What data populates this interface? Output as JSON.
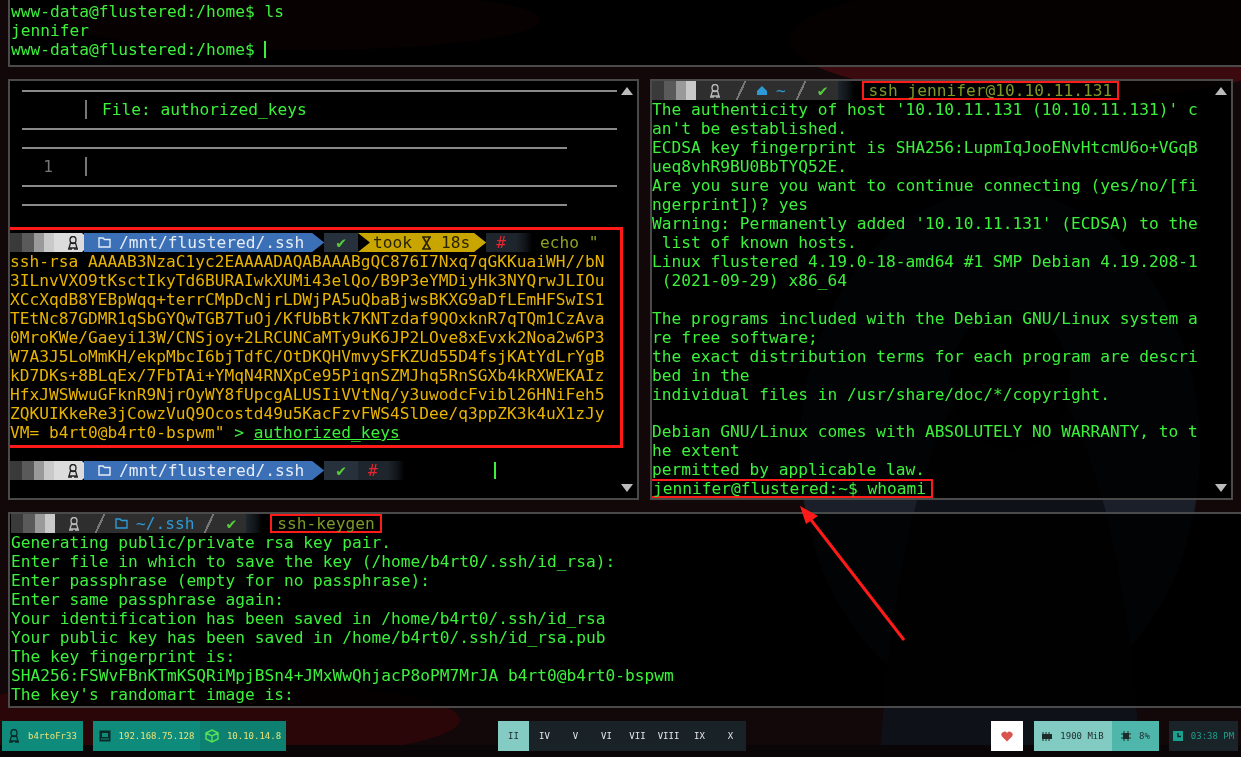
{
  "top_pane": {
    "lines": [
      {
        "text": "www-data@flustered:/home$ ls",
        "cursor": false
      },
      {
        "text": "jennifer",
        "cursor": false
      },
      {
        "text": "www-data@flustered:/home$ ",
        "cursor": true
      }
    ]
  },
  "left_pane": {
    "file_header": {
      "label": "File: authorized_keys",
      "line_number": "1"
    },
    "commands": [
      {
        "highlighted": true,
        "cursor": false,
        "prompt": {
          "segments": [
            {
              "kind": "os"
            },
            {
              "kind": "path",
              "text": "/mnt/flustered/.ssh"
            },
            {
              "kind": "status",
              "text": "✔"
            },
            {
              "kind": "duration",
              "text": "took",
              "value": "18s"
            },
            {
              "kind": "root",
              "text": "#"
            }
          ]
        },
        "command": "echo \"",
        "output": [
          "ssh-rsa AAAAB3NzaC1yc2EAAAADAQABAAABgQC876I7Nxq7qGKKuaiWH//bN",
          "3ILnvVXO9tKsctIkyTd6BURAIwkXUMi43elQo/B9P3eYMDiyHk3NYQrwJLIOu",
          "XCcXqdB8YEBpWqq+terrCMpDcNjrLDWjPA5uQbaBjwsBKXG9aDfLEmHFSwIS1",
          "TEtNc87GDMR1qSbGYQwTGB7TuOj/KfUbBtk7KNTzdaf9QOxknR7qTQm1CzAva",
          "0MroKWe/Gaeyi13W/CNSjoy+2LRCUNCaMTy9uK6JP2LOve8xEvxk2Noa2w6P3",
          "W7A3J5LoMmKH/ekpMbcI6bjTdfC/OtDKQHVmvySFKZUd55D4fsjKAtYdLrYgB",
          "kD7DKs+8BLqEx/7FbTAi+YMqN4RNXpCe95PiqnSZMJhq5RnSGXb4kRXWEKAIz",
          "HfxJWSWwuGFknR9NjrOyWY8fUpcgALUSIiVVtNq/y3uwodcFvibl26HNiFeh5",
          "ZQKUIKkeRe3jCowzVuQ9Ocostd49u5KacFzvFWS4SlDee/q3ppZK3k4uX1zJy",
          "VM= b4rt0@b4rt0-bspwm\""
        ],
        "redirect": ">",
        "target": "authorized_keys"
      },
      {
        "highlighted": false,
        "cursor": true,
        "prompt": {
          "segments": [
            {
              "kind": "os"
            },
            {
              "kind": "path",
              "text": "/mnt/flustered/.ssh"
            },
            {
              "kind": "status",
              "text": "✔"
            },
            {
              "kind": "root",
              "text": "#"
            }
          ]
        }
      }
    ]
  },
  "right_pane": {
    "prompt": {
      "segments": [
        {
          "kind": "os"
        },
        {
          "kind": "home",
          "text": "~"
        },
        {
          "kind": "status",
          "text": "✔"
        }
      ]
    },
    "command": "ssh jennifer@10.10.11.131",
    "command_highlighted": true,
    "output": [
      {
        "kind": "text",
        "text": "The authenticity of host '10.10.11.131 (10.10.11.131)' c"
      },
      {
        "kind": "text",
        "text": "an't be established."
      },
      {
        "kind": "text",
        "text": "ECDSA key fingerprint is SHA256:LupmIqJooENvHtcmU6o+VGqB"
      },
      {
        "kind": "text",
        "text": "ueq8vhR9BU0BbTYQ52E."
      },
      {
        "kind": "text",
        "text": "Are you sure you want to continue connecting (yes/no/[fi"
      },
      {
        "kind": "text",
        "text": "ngerprint])? yes"
      },
      {
        "kind": "text",
        "text": "Warning: Permanently added '10.10.11.131' (ECDSA) to the"
      },
      {
        "kind": "text",
        "text": " list of known hosts."
      },
      {
        "kind": "text",
        "text": "Linux flustered 4.19.0-18-amd64 #1 SMP Debian 4.19.208-1"
      },
      {
        "kind": "text",
        "text": " (2021-09-29) x86_64"
      },
      {
        "kind": "blank"
      },
      {
        "kind": "text",
        "text": "The programs included with the Debian GNU/Linux system a"
      },
      {
        "kind": "text",
        "text": "re free software;"
      },
      {
        "kind": "text",
        "text": "the exact distribution terms for each program are descri"
      },
      {
        "kind": "text",
        "text": "bed in the"
      },
      {
        "kind": "text",
        "text": "individual files in /usr/share/doc/*/copyright."
      },
      {
        "kind": "blank"
      },
      {
        "kind": "text",
        "text": "Debian GNU/Linux comes with ABSOLUTELY NO WARRANTY, to t"
      },
      {
        "kind": "text",
        "text": "he extent"
      },
      {
        "kind": "text",
        "text": "permitted by applicable law."
      }
    ],
    "final_prompt": {
      "text": "jennifer@flustered:~$ whoami",
      "highlighted": true
    }
  },
  "bottom_pane": {
    "prompt": {
      "segments": [
        {
          "kind": "os"
        },
        {
          "kind": "path",
          "text": "~/.ssh"
        },
        {
          "kind": "status",
          "text": "✔"
        }
      ]
    },
    "command": "ssh-keygen",
    "command_highlighted": true,
    "output": [
      {
        "kind": "text",
        "text": "Generating public/private rsa key pair."
      },
      {
        "kind": "text",
        "text": "Enter file in which to save the key (/home/b4rt0/.ssh/id_rsa):"
      },
      {
        "kind": "text",
        "text": "Enter passphrase (empty for no passphrase):"
      },
      {
        "kind": "text",
        "text": "Enter same passphrase again:"
      },
      {
        "kind": "text",
        "text": "Your identification has been saved in /home/b4rt0/.ssh/id_rsa"
      },
      {
        "kind": "text",
        "text": "Your public key has been saved in /home/b4rt0/.ssh/id_rsa.pub"
      },
      {
        "kind": "text",
        "text": "The key fingerprint is:"
      },
      {
        "kind": "text",
        "text": "SHA256:FSWvFBnKTmKSQRiMpjBSn4+JMxWwQhjacP8oPM7MrJA b4rt0@b4rt0-bspwm"
      },
      {
        "kind": "text",
        "text": "The key's randomart image is:"
      }
    ]
  },
  "annotation_arrow": true,
  "taskbar": {
    "user": "b4rtoFr33",
    "network": [
      {
        "kind": "ethernet",
        "text": "192.168.75.128"
      },
      {
        "kind": "vpn",
        "text": "10.10.14.8"
      }
    ],
    "workspaces": [
      {
        "label": "II",
        "selected": true
      },
      {
        "label": "IV",
        "selected": false
      },
      {
        "label": "V",
        "selected": false
      },
      {
        "label": "VI",
        "selected": false
      },
      {
        "label": "VII",
        "selected": false
      },
      {
        "label": "VIII",
        "selected": false
      },
      {
        "label": "IX",
        "selected": false
      },
      {
        "label": "X",
        "selected": false
      }
    ],
    "memory": "1900 MiB",
    "cpu": "8%",
    "clock": "03:38 PM"
  }
}
